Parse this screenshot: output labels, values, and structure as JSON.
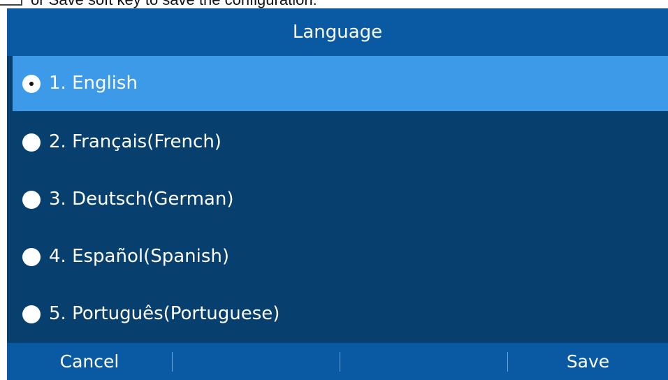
{
  "doc_snippet": {
    "text": "or Save soft key to save the configuration."
  },
  "screen": {
    "title": "Language",
    "items": [
      {
        "label": "1.  English",
        "selected": true
      },
      {
        "label": "2.  Français(French)",
        "selected": false
      },
      {
        "label": "3.  Deutsch(German)",
        "selected": false
      },
      {
        "label": "4.  Español(Spanish)",
        "selected": false
      },
      {
        "label": "5.  Português(Portuguese)",
        "selected": false
      }
    ],
    "softkeys": {
      "cancel": "Cancel",
      "key2": "",
      "key3": "",
      "save": "Save"
    }
  },
  "colors": {
    "header_bg": "#0a5aa3",
    "list_bg": "#073f6f",
    "selected_bg": "#3d9ae8"
  }
}
